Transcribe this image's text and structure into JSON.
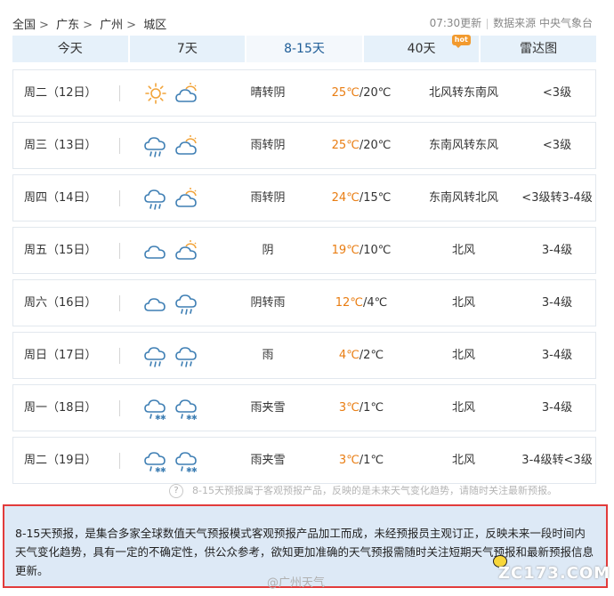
{
  "breadcrumb": {
    "items": [
      "全国",
      "广东",
      "广州",
      "城区"
    ],
    "sep": ">"
  },
  "header": {
    "update_time": "07:30更新",
    "source": "数据来源 中央气象台"
  },
  "tabs": [
    {
      "label": "今天"
    },
    {
      "label": "7天"
    },
    {
      "label": "8-15天",
      "active": true
    },
    {
      "label": "40天",
      "badge": "hot"
    },
    {
      "label": "雷达图"
    }
  ],
  "forecast": [
    {
      "day": "周二（12日）",
      "icon1": "sun-icon",
      "icon2": "cloudy-icon",
      "desc": "晴转阴",
      "hi": "25℃",
      "lo": "/20℃",
      "wind": "北风转东南风",
      "level": "<3级"
    },
    {
      "day": "周三（13日）",
      "icon1": "rain-icon",
      "icon2": "cloudy-icon",
      "desc": "雨转阴",
      "hi": "25℃",
      "lo": "/20℃",
      "wind": "东南风转东风",
      "level": "<3级"
    },
    {
      "day": "周四（14日）",
      "icon1": "rain-icon",
      "icon2": "cloudy-icon",
      "desc": "雨转阴",
      "hi": "24℃",
      "lo": "/15℃",
      "wind": "东南风转北风",
      "level": "<3级转3-4级"
    },
    {
      "day": "周五（15日）",
      "icon1": "overcast-icon",
      "icon2": "cloudy-icon",
      "desc": "阴",
      "hi": "19℃",
      "lo": "/10℃",
      "wind": "北风",
      "level": "3-4级"
    },
    {
      "day": "周六（16日）",
      "icon1": "overcast-icon",
      "icon2": "rain-icon",
      "desc": "阴转雨",
      "hi": "12℃",
      "lo": "/4℃",
      "wind": "北风",
      "level": "3-4级"
    },
    {
      "day": "周日（17日）",
      "icon1": "rain-icon",
      "icon2": "rain-icon",
      "desc": "雨",
      "hi": "4℃",
      "lo": "/2℃",
      "wind": "北风",
      "level": "3-4级"
    },
    {
      "day": "周一（18日）",
      "icon1": "sleet-icon",
      "icon2": "sleet-icon",
      "desc": "雨夹雪",
      "hi": "3℃",
      "lo": "/1℃",
      "wind": "北风",
      "level": "3-4级"
    },
    {
      "day": "周二（19日）",
      "icon1": "sleet-icon",
      "icon2": "sleet-icon",
      "desc": "雨夹雪",
      "hi": "3℃",
      "lo": "/1℃",
      "wind": "北风",
      "level": "3-4级转<3级"
    }
  ],
  "note": "8-15天预报属于客观预报产品，反映的是未来天气变化趋势，请随时关注最新预报。",
  "note_icon": "?",
  "disclaimer": "8-15天预报，是集合多家全球数值天气预报模式客观预报产品加工而成，未经预报员主观订正，反映未来一段时间内天气变化趋势，具有一定的不确定性，供公众参考，欲知更加准确的天气预报需随时关注短期天气预报和最新预报信息更新。",
  "watermarks": [
    "@广州天气",
    "ZC173.COM"
  ],
  "colors": {
    "accent": "#1e5d97",
    "temp_high": "#e97d12",
    "highlight_border": "#e23b3b",
    "disclaimer_bg": "#dde9f6",
    "icon_stroke": "#3f7fb4",
    "sun": "#f2a43a"
  }
}
